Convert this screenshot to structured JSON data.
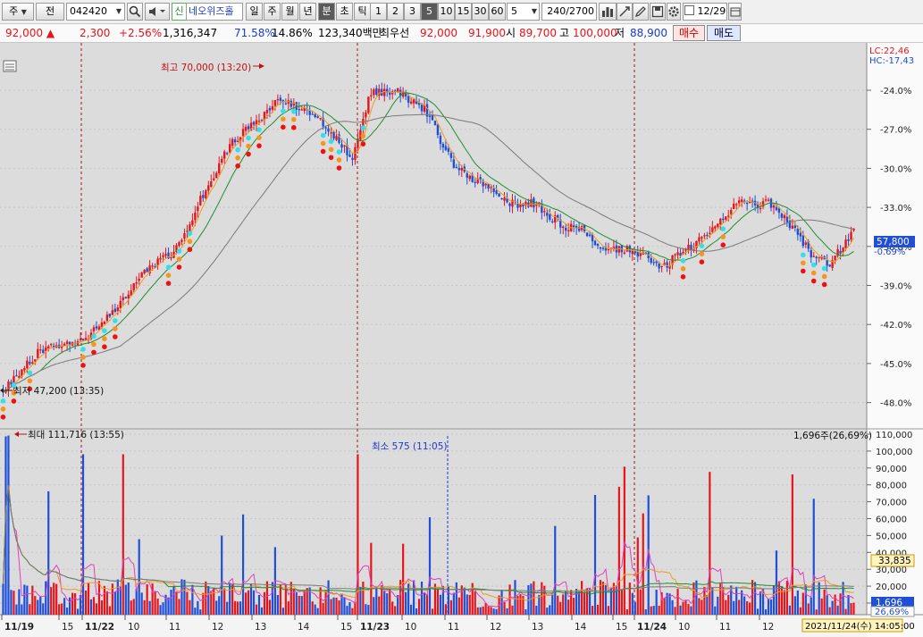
{
  "toolbar": {
    "market": "주",
    "prefix": "전",
    "code": "042420",
    "badge": "신",
    "stock_name": "네오위즈홀",
    "periods": [
      "일",
      "주",
      "월",
      "년"
    ],
    "units": [
      "분",
      "초",
      "틱"
    ],
    "selected_unit": "분",
    "intervals": [
      "1",
      "2",
      "3",
      "5",
      "10",
      "15",
      "30",
      "60"
    ],
    "selected_interval": "5",
    "interval_input": "5",
    "count_value": "240",
    "count_total": "/2700",
    "date": "12/29",
    "colors": {
      "accent_green": "#2f8a3b",
      "selected_bg": "#5a5a5a"
    }
  },
  "quote": {
    "price": "92,000",
    "change": "2,300",
    "change_pct": "+2.56%",
    "volume": "1,316,347",
    "turnover_pct": "71.58%",
    "ratio_pct": "14.86%",
    "amount": "123,340백만",
    "prev_label": "최우선",
    "ask": "92,000",
    "bid": "91,900",
    "open_label": "시",
    "open": "89,700",
    "high_label": "고",
    "high": "100,000",
    "low_label": "저",
    "low": "88,900",
    "buy_label": "매수",
    "sell_label": "매도"
  },
  "price_panel": {
    "lc_label": "LC:22,46",
    "hc_label": "HC:-17,43",
    "y_ticks": [
      "-24.0%",
      "-27.0%",
      "-30.0%",
      "-33.0%",
      "-36.0%",
      "-39.0%",
      "-42.0%",
      "-45.0%",
      "-48.0%"
    ],
    "current_label": "57,800",
    "current_pct": "-0.69%",
    "high_annotation": "최고 70,000 (13:20)",
    "low_annotation": "최저 47,200 (13:35)"
  },
  "volume_panel": {
    "y_ticks": [
      "110,000",
      "100,000",
      "90,000",
      "80,000",
      "70,000",
      "60,000",
      "50,000",
      "40,000",
      "30,000",
      "20,000",
      "10,000"
    ],
    "max_annotation": "최대 111,716 (13:55)",
    "min_annotation": "최소 575 (11:05)",
    "current_annotation": "1,696주(26,69%)",
    "tag_a": "33,835",
    "tag_b": "1,696",
    "tag_c": "26,69%"
  },
  "x_axis": {
    "labels": [
      "11/19",
      "15",
      "11/22",
      "10",
      "11",
      "12",
      "13",
      "14",
      "15",
      "11/23",
      "10",
      "11",
      "12",
      "13",
      "14",
      "15",
      "11/24",
      "10",
      "11",
      "12"
    ],
    "cursor_time": "2021/11/24(수) 14:05:00"
  },
  "colors": {
    "up": "#e8141c",
    "down": "#1f4ed8",
    "ma_fast": "#f29a1a",
    "ma_mid": "#1d8f2e",
    "ma_slow": "#7a7a7a",
    "vol_ma": "#e040c0",
    "signal_cyan": "#33dfe8",
    "signal_orange": "#f7941d",
    "signal_red": "#ee1111",
    "divider": "#a01818",
    "min_marker": "#2038d0"
  }
}
